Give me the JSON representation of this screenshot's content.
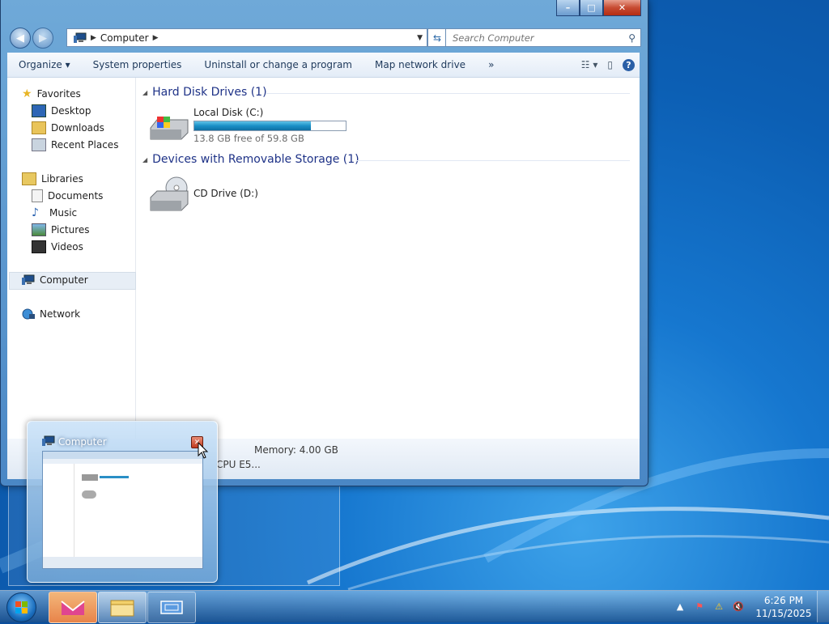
{
  "window": {
    "title": "Computer",
    "controls": {
      "minimize": "–",
      "maximize": "□",
      "close": "✕"
    }
  },
  "nav": {
    "address_path": "Computer",
    "search_placeholder": "Search Computer"
  },
  "toolbar": {
    "organize": "Organize",
    "system_properties": "System properties",
    "uninstall": "Uninstall or change a program",
    "map_drive": "Map network drive",
    "more": "»"
  },
  "sidebar": {
    "favorites": "Favorites",
    "desktop": "Desktop",
    "downloads": "Downloads",
    "recent_places": "Recent Places",
    "libraries": "Libraries",
    "documents": "Documents",
    "music": "Music",
    "pictures": "Pictures",
    "videos": "Videos",
    "computer": "Computer",
    "network": "Network"
  },
  "main": {
    "hdd_group": "Hard Disk Drives (1)",
    "local_disk_name": "Local Disk (C:)",
    "local_disk_free": "13.8 GB free of 59.8 GB",
    "local_disk_used_fraction": 0.77,
    "removable_group": "Devices with Removable Storage (1)",
    "cd_drive_name": "CD Drive (D:)"
  },
  "details": {
    "memory": "Memory: 4.00 GB",
    "cpu_fragment": "CPU E5..."
  },
  "preview": {
    "title": "Computer"
  },
  "taskbar": {
    "time": "6:26 PM",
    "date": "11/15/2025"
  },
  "colors": {
    "desktop_blue": "#1677cf",
    "group_header": "#1e3287",
    "close_red": "#c74b32"
  }
}
